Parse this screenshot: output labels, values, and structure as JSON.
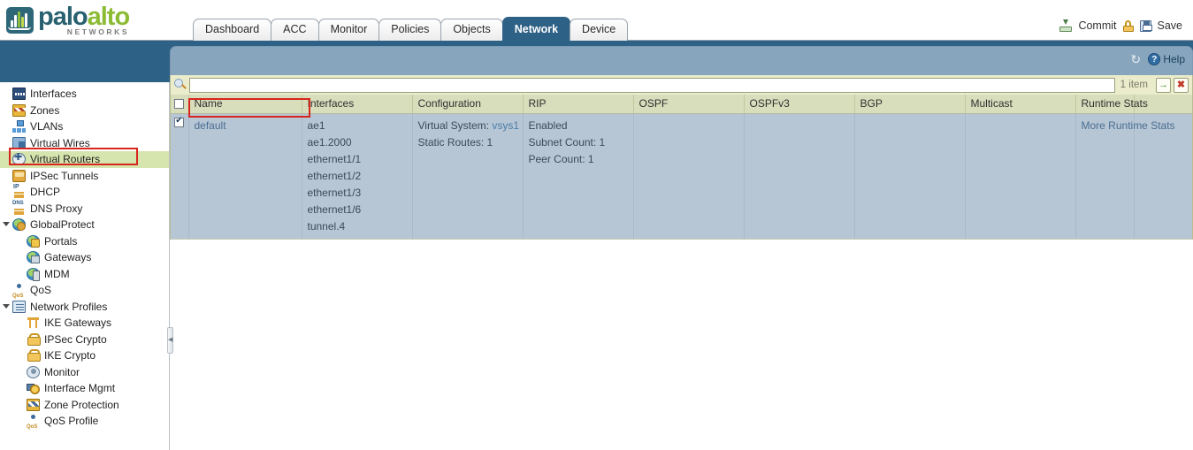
{
  "brand": {
    "word_palo": "palo",
    "word_alto": "alto",
    "subtitle": "NETWORKS",
    "logo_teal": "#2a6170",
    "logo_green": "#8cbb34"
  },
  "topnav": {
    "tabs": [
      {
        "label": "Dashboard",
        "active": false
      },
      {
        "label": "ACC",
        "active": false
      },
      {
        "label": "Monitor",
        "active": false
      },
      {
        "label": "Policies",
        "active": false
      },
      {
        "label": "Objects",
        "active": false
      },
      {
        "label": "Network",
        "active": true
      },
      {
        "label": "Device",
        "active": false
      }
    ],
    "commit_label": "Commit",
    "save_label": "Save",
    "active_tab_color": "#2e6186"
  },
  "sidebar": {
    "items": [
      {
        "label": "Interfaces",
        "icon": "interfaces-icon",
        "indent": 0,
        "twisty": false,
        "selected": false,
        "glyph": "g-interfaces"
      },
      {
        "label": "Zones",
        "icon": "zones-icon",
        "indent": 0,
        "twisty": false,
        "selected": false,
        "glyph": "g-zones"
      },
      {
        "label": "VLANs",
        "icon": "vlans-icon",
        "indent": 0,
        "twisty": false,
        "selected": false,
        "glyph": "g-vlan"
      },
      {
        "label": "Virtual Wires",
        "icon": "virtual-wires-icon",
        "indent": 0,
        "twisty": false,
        "selected": false,
        "glyph": "g-vwire"
      },
      {
        "label": "Virtual Routers",
        "icon": "virtual-routers-icon",
        "indent": 0,
        "twisty": false,
        "selected": true,
        "glyph": "g-vrouter"
      },
      {
        "label": "IPSec Tunnels",
        "icon": "ipsec-tunnels-icon",
        "indent": 0,
        "twisty": false,
        "selected": false,
        "glyph": "g-ipsec"
      },
      {
        "label": "DHCP",
        "icon": "dhcp-icon",
        "indent": 0,
        "twisty": false,
        "selected": false,
        "glyph": "g-dhcp"
      },
      {
        "label": "DNS Proxy",
        "icon": "dns-proxy-icon",
        "indent": 0,
        "twisty": false,
        "selected": false,
        "glyph": "g-dns"
      },
      {
        "label": "GlobalProtect",
        "icon": "globalprotect-icon",
        "indent": 0,
        "twisty": true,
        "selected": false,
        "glyph": "g-globe g-gp"
      },
      {
        "label": "Portals",
        "icon": "portals-icon",
        "indent": 1,
        "twisty": false,
        "selected": false,
        "glyph": "g-globe g-portal"
      },
      {
        "label": "Gateways",
        "icon": "gateways-icon",
        "indent": 1,
        "twisty": false,
        "selected": false,
        "glyph": "g-globe g-gw"
      },
      {
        "label": "MDM",
        "icon": "mdm-icon",
        "indent": 1,
        "twisty": false,
        "selected": false,
        "glyph": "g-globe g-mdm"
      },
      {
        "label": "QoS",
        "icon": "qos-icon",
        "indent": 0,
        "twisty": false,
        "selected": false,
        "glyph": "g-qos"
      },
      {
        "label": "Network Profiles",
        "icon": "network-profiles-icon",
        "indent": 0,
        "twisty": true,
        "selected": false,
        "glyph": "g-netprof"
      },
      {
        "label": "IKE Gateways",
        "icon": "ike-gateways-icon",
        "indent": 1,
        "twisty": false,
        "selected": false,
        "glyph": "g-ikegw"
      },
      {
        "label": "IPSec Crypto",
        "icon": "ipsec-crypto-icon",
        "indent": 1,
        "twisty": false,
        "selected": false,
        "glyph": "g-padlock"
      },
      {
        "label": "IKE Crypto",
        "icon": "ike-crypto-icon",
        "indent": 1,
        "twisty": false,
        "selected": false,
        "glyph": "g-padlock"
      },
      {
        "label": "Monitor",
        "icon": "monitor-icon",
        "indent": 1,
        "twisty": false,
        "selected": false,
        "glyph": "g-monitor"
      },
      {
        "label": "Interface Mgmt",
        "icon": "interface-mgmt-icon",
        "indent": 1,
        "twisty": false,
        "selected": false,
        "glyph": "g-ifmgmt"
      },
      {
        "label": "Zone Protection",
        "icon": "zone-protection-icon",
        "indent": 1,
        "twisty": false,
        "selected": false,
        "glyph": "g-zoneprot"
      },
      {
        "label": "QoS Profile",
        "icon": "qos-profile-icon",
        "indent": 1,
        "twisty": false,
        "selected": false,
        "glyph": "g-qos"
      }
    ],
    "selected_bg": "#d6e4ae",
    "annotation_color": "#d7261c",
    "splitter_glyph": "◀"
  },
  "panel": {
    "refresh_glyph": "↻",
    "help_glyph": "?",
    "help_label": "Help",
    "search": {
      "value": "",
      "placeholder": "",
      "item_count": "1 item",
      "go_glyph": "→",
      "clear_glyph": "✖"
    },
    "table": {
      "columns": [
        "Name",
        "Interfaces",
        "Configuration",
        "RIP",
        "OSPF",
        "OSPFv3",
        "BGP",
        "Multicast",
        "Runtime Stats"
      ],
      "rows": [
        {
          "checked": true,
          "name": "default",
          "interfaces": [
            "ae1",
            "ae1.2000",
            "ethernet1/1",
            "ethernet1/2",
            "ethernet1/3",
            "ethernet1/6",
            "tunnel.4"
          ],
          "configuration": {
            "virtual_system_label": "Virtual System:",
            "virtual_system_value": "vsys1",
            "static_routes": "Static Routes: 1"
          },
          "rip": [
            "Enabled",
            "Subnet Count: 1",
            "Peer Count: 1"
          ],
          "ospf": "",
          "ospfv3": "",
          "bgp": "",
          "multicast": "",
          "runtime_stats": "More Runtime Stats"
        }
      ]
    }
  }
}
